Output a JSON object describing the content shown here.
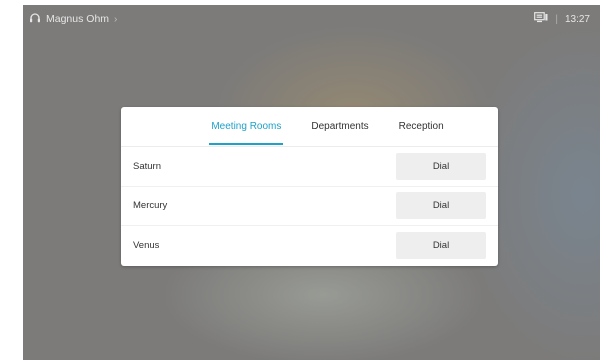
{
  "topbar": {
    "user_name": "Magnus Ohm",
    "chevron": "›",
    "separator": "|",
    "time": "13:27",
    "icons": {
      "left": "headset-icon",
      "right": "screen-share-icon"
    }
  },
  "directory": {
    "tabs": [
      {
        "label": "Meeting Rooms",
        "active": true
      },
      {
        "label": "Departments",
        "active": false
      },
      {
        "label": "Reception",
        "active": false
      }
    ],
    "rows": [
      {
        "name": "Saturn",
        "action": "Dial"
      },
      {
        "name": "Mercury",
        "action": "Dial"
      },
      {
        "name": "Venus",
        "action": "Dial"
      }
    ]
  },
  "colors": {
    "accent": "#1fa1c8",
    "background": "#7c7b7a",
    "panel": "#ffffff",
    "button": "#eeeeee"
  }
}
